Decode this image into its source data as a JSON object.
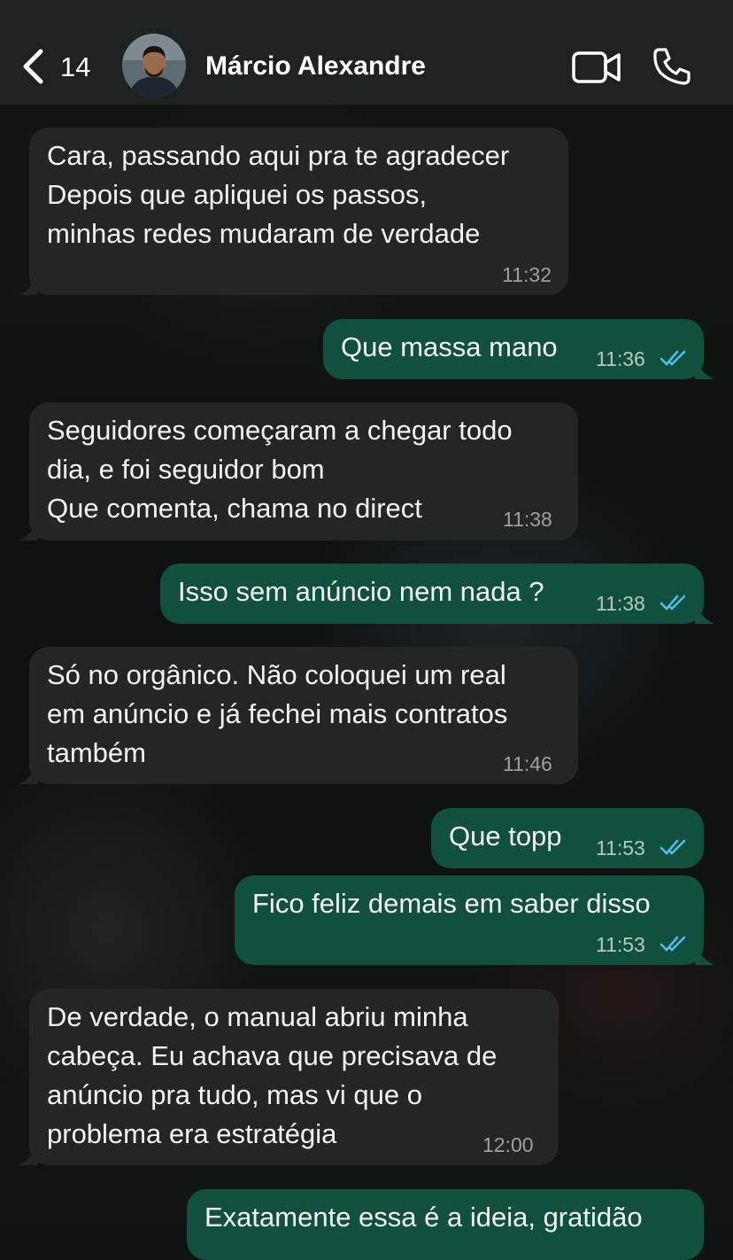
{
  "header": {
    "back_count": "14",
    "contact_name": "Márcio Alexandre",
    "icons": [
      "chevron-left-icon",
      "video-camera-icon",
      "phone-icon"
    ]
  },
  "messages": [
    {
      "direction": "incoming",
      "lines": [
        "Cara, passando aqui pra te agradecer",
        "Depois que apliquei os passos,",
        "minhas redes mudaram de verdade"
      ],
      "time": "11:32"
    },
    {
      "direction": "outgoing",
      "lines": [
        "Que massa mano"
      ],
      "time": "11:36",
      "status": "read"
    },
    {
      "direction": "incoming",
      "lines": [
        "Seguidores começaram a chegar todo",
        "dia, e foi seguidor bom",
        "Que comenta, chama no direct"
      ],
      "time": "11:38"
    },
    {
      "direction": "outgoing",
      "lines": [
        "Isso sem anúncio nem nada ?"
      ],
      "time": "11:38",
      "status": "read"
    },
    {
      "direction": "incoming",
      "lines": [
        "Só no orgânico. Não coloquei um real",
        "em anúncio e já fechei mais contratos",
        "também"
      ],
      "time": "11:46"
    },
    {
      "direction": "outgoing",
      "lines": [
        "Que topp"
      ],
      "time": "11:53",
      "status": "read"
    },
    {
      "direction": "outgoing",
      "lines": [
        "Fico feliz demais em saber disso"
      ],
      "time": "11:53",
      "status": "read"
    },
    {
      "direction": "incoming",
      "lines": [
        "De verdade, o manual abriu minha",
        "cabeça. Eu achava que precisava de",
        "anúncio pra tudo, mas vi que o",
        "problema era estratégia"
      ],
      "time": "12:00"
    },
    {
      "direction": "outgoing",
      "lines": [
        "Exatamente essa é a ideia, gratidão"
      ],
      "time": "",
      "status": ""
    }
  ],
  "colors": {
    "incoming_bubble": "#232625",
    "outgoing_bubble": "#11503d",
    "read_ticks": "#53bdeb",
    "header_bg": "#1e2220"
  }
}
